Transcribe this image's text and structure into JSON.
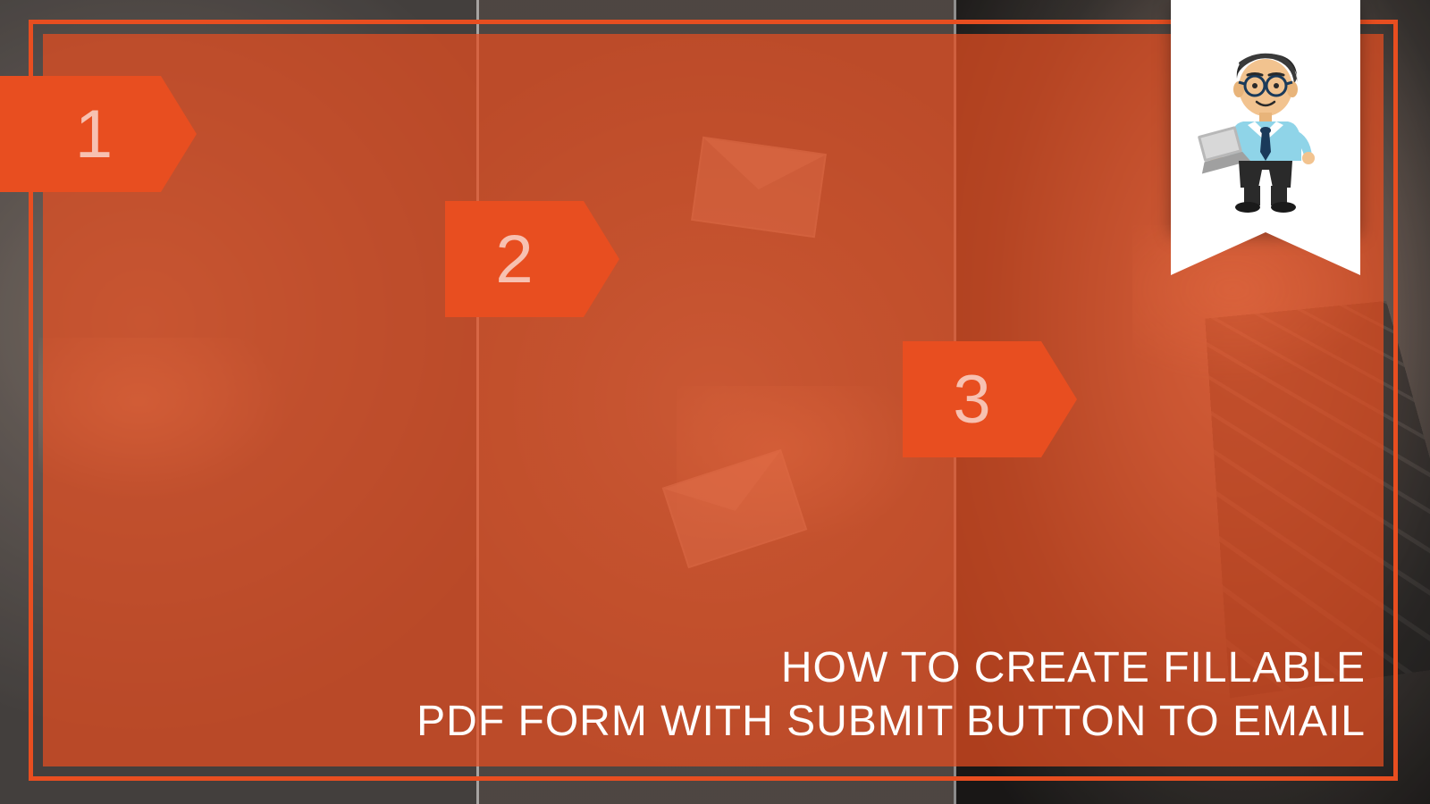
{
  "steps": {
    "one": "1",
    "two": "2",
    "three": "3"
  },
  "title": {
    "line1": "HOW TO CREATE FILLABLE",
    "line2": "PDF FORM WITH SUBMIT BUTTON TO EMAIL"
  },
  "colors": {
    "accent": "#e84e20",
    "text": "#ffffff",
    "ribbon": "#ffffff"
  },
  "mascot": {
    "hair": "#2a2a2a",
    "skin": "#f2c38f",
    "shirt": "#8fd4e8",
    "tie": "#1a3a5a",
    "pants": "#2a2a2a",
    "laptop": "#b8b8b8",
    "glasses": "#1a3a5a"
  }
}
